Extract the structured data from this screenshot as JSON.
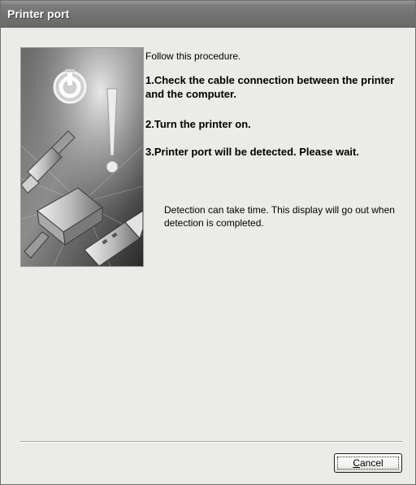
{
  "window": {
    "title": "Printer port"
  },
  "content": {
    "intro": "Follow this procedure.",
    "steps": [
      "1.Check the cable connection between the printer and the computer.",
      "2.Turn the printer on.",
      "3.Printer port will be detected. Please wait."
    ],
    "note": "Detection can take time. This display will go out when detection is completed."
  },
  "buttons": {
    "cancel_mnemonic": "C",
    "cancel_rest": "ancel"
  },
  "illustration": {
    "icons": [
      "power-icon",
      "exclamation-icon",
      "usb-connector-icon",
      "parallel-connector-icon"
    ]
  },
  "colors": {
    "title_bar": "#747474",
    "window_bg": "#ebebe7",
    "text": "#000000"
  }
}
